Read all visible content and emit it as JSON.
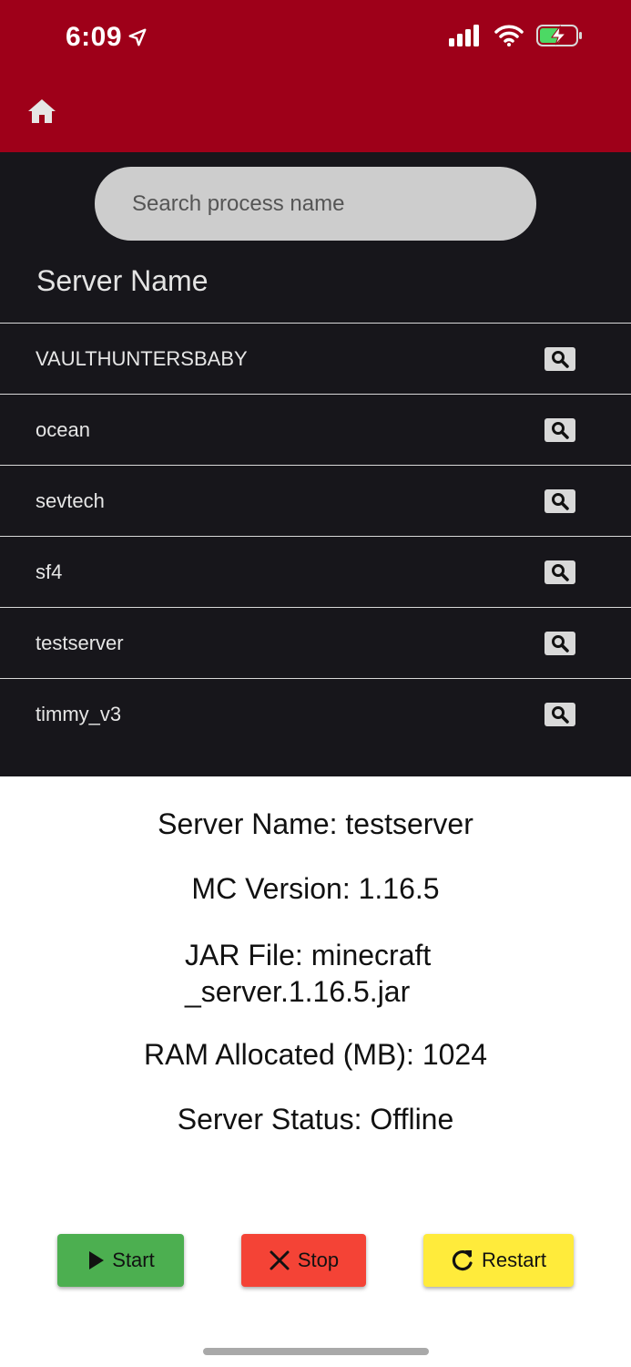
{
  "status_bar": {
    "time": "6:09"
  },
  "search": {
    "placeholder": "Search process name"
  },
  "list": {
    "header": "Server Name",
    "servers": [
      "VAULTHUNTERSBABY",
      "ocean",
      "sevtech",
      "sf4",
      "testserver",
      "timmy_v3"
    ]
  },
  "details": {
    "server_name": "Server Name: testserver",
    "mc_version": "MC Version: 1.16.5",
    "jar_file_line1": "JAR File: minecraft",
    "jar_file_line2": "_server.1.16.5.jar",
    "ram": "RAM Allocated (MB): 1024",
    "status": "Server Status: Offline"
  },
  "actions": {
    "start": "Start",
    "stop": "Stop",
    "restart": "Restart"
  },
  "colors": {
    "top_bar": "#9e0019",
    "panel": "#17161b",
    "start": "#4caf50",
    "stop": "#f44336",
    "restart": "#ffeb3b"
  }
}
